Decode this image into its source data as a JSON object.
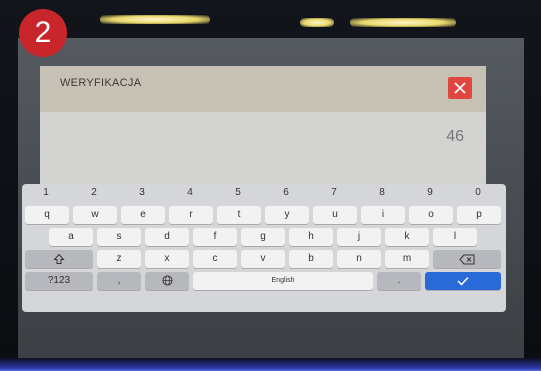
{
  "badge": {
    "number": "2"
  },
  "dialog": {
    "title": "WERYFIKACJA",
    "value": "46",
    "input_value": "......",
    "icons": {
      "close": "close-icon",
      "input_end": "chevron-down-icon"
    },
    "colors": {
      "close_bg": "#e0463f",
      "header": "#c7c0b4"
    }
  },
  "keyboard": {
    "numbers": [
      "1",
      "2",
      "3",
      "4",
      "5",
      "6",
      "7",
      "8",
      "9",
      "0"
    ],
    "row1": [
      "q",
      "w",
      "e",
      "r",
      "t",
      "y",
      "u",
      "i",
      "o",
      "p"
    ],
    "row2": [
      "a",
      "s",
      "d",
      "f",
      "g",
      "h",
      "j",
      "k",
      "l"
    ],
    "row3": [
      "z",
      "x",
      "c",
      "v",
      "b",
      "n",
      "m"
    ],
    "symbols_label": "?123",
    "comma_label": ",",
    "space_label": "English",
    "period_label": ".",
    "icons": {
      "shift": "shift-icon",
      "backspace": "backspace-icon",
      "globe": "globe-icon",
      "enter": "checkmark-icon"
    },
    "colors": {
      "enter_key": "#2a6ad8"
    }
  }
}
